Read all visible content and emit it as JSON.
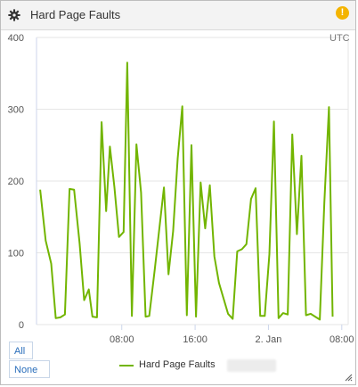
{
  "widget": {
    "title": "Hard Page Faults",
    "gear_icon": "gear-icon",
    "warning_icon": "warning-icon",
    "warning_symbol": "!",
    "accent_color": "#72b500"
  },
  "buttons": {
    "all_label": "All",
    "none_label": "None"
  },
  "chart_data": {
    "type": "line",
    "timezone_label": "UTC",
    "y_ticks": [
      "0",
      "100",
      "200",
      "300",
      "400"
    ],
    "ylim": [
      0,
      400
    ],
    "x_ticks": [
      {
        "label": "08:00",
        "at": 9.5
      },
      {
        "label": "16:00",
        "at": 17.5
      },
      {
        "label": "2. Jan",
        "at": 25.5
      },
      {
        "label": "08:00",
        "at": 33.5
      }
    ],
    "xlim": [
      0.2,
      34.2
    ],
    "grid": true,
    "legend": "bottom",
    "series": [
      {
        "name": "Hard Page Faults",
        "color": "#72b500",
        "points": [
          [
            0.6,
            188
          ],
          [
            1.2,
            117
          ],
          [
            1.8,
            85
          ],
          [
            2.3,
            9
          ],
          [
            2.8,
            10
          ],
          [
            3.3,
            14
          ],
          [
            3.8,
            189
          ],
          [
            4.3,
            188
          ],
          [
            4.9,
            113
          ],
          [
            5.4,
            34
          ],
          [
            5.9,
            49
          ],
          [
            6.3,
            11
          ],
          [
            6.8,
            10
          ],
          [
            7.3,
            282
          ],
          [
            7.8,
            158
          ],
          [
            8.2,
            248
          ],
          [
            8.7,
            191
          ],
          [
            9.2,
            122
          ],
          [
            9.7,
            129
          ],
          [
            10.1,
            365
          ],
          [
            10.6,
            12
          ],
          [
            11.1,
            251
          ],
          [
            11.6,
            184
          ],
          [
            12.1,
            11
          ],
          [
            12.5,
            12
          ],
          [
            13.1,
            77
          ],
          [
            14.1,
            191
          ],
          [
            14.6,
            70
          ],
          [
            15.1,
            130
          ],
          [
            15.6,
            231
          ],
          [
            16.1,
            304
          ],
          [
            16.6,
            13
          ],
          [
            17.1,
            250
          ],
          [
            17.6,
            11
          ],
          [
            18.1,
            198
          ],
          [
            18.6,
            134
          ],
          [
            19.1,
            194
          ],
          [
            19.6,
            95
          ],
          [
            20.1,
            58
          ],
          [
            21.1,
            15
          ],
          [
            21.6,
            8
          ],
          [
            22.1,
            102
          ],
          [
            22.6,
            105
          ],
          [
            23.1,
            112
          ],
          [
            23.6,
            175
          ],
          [
            24.1,
            190
          ],
          [
            24.6,
            12
          ],
          [
            25.1,
            12
          ],
          [
            25.6,
            98
          ],
          [
            26.1,
            283
          ],
          [
            26.6,
            9
          ],
          [
            27.1,
            16
          ],
          [
            27.6,
            14
          ],
          [
            28.1,
            265
          ],
          [
            28.6,
            126
          ],
          [
            29.1,
            235
          ],
          [
            29.6,
            13
          ],
          [
            30.1,
            15
          ],
          [
            30.6,
            11
          ],
          [
            31.1,
            7
          ],
          [
            31.6,
            170
          ],
          [
            32.1,
            303
          ],
          [
            32.5,
            11
          ]
        ]
      }
    ]
  }
}
